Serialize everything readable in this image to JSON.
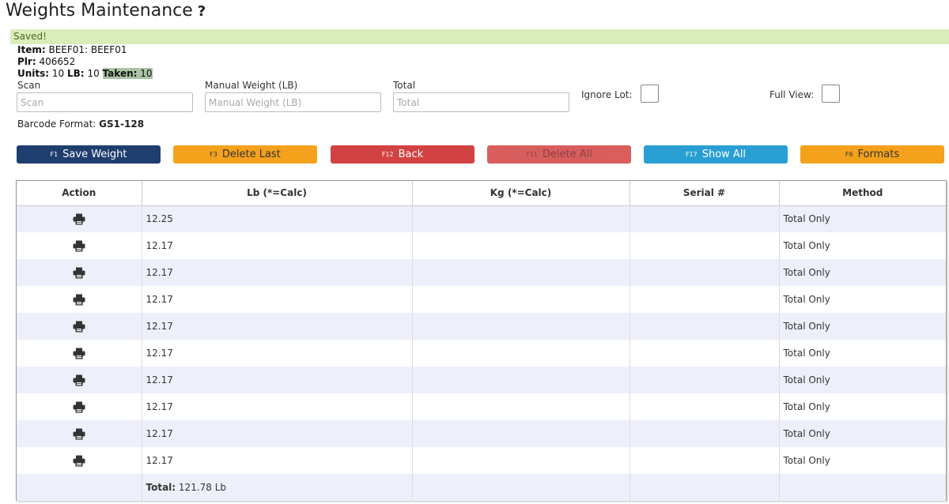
{
  "header": {
    "title": "Weights Maintenance",
    "help": "?"
  },
  "alert": {
    "text": "Saved!"
  },
  "info": {
    "item_label": "Item:",
    "item_value": "BEEF01: BEEF01",
    "plr_label": "Plr:",
    "plr_value": "406652",
    "units_label": "Units:",
    "units_value": "10",
    "lb_label": "LB:",
    "lb_value": "10",
    "taken_label": "Taken:",
    "taken_value": "10"
  },
  "form": {
    "scan": {
      "label": "Scan",
      "placeholder": "Scan"
    },
    "manual": {
      "label": "Manual Weight (LB)",
      "placeholder": "Manual Weight (LB)"
    },
    "total": {
      "label": "Total",
      "placeholder": "Total"
    },
    "ignore_lot": {
      "label": "Ignore Lot:"
    },
    "full_view": {
      "label": "Full View:"
    }
  },
  "barcode": {
    "label": "Barcode Format:",
    "value": "GS1-128"
  },
  "buttons": {
    "save": {
      "key": "F1",
      "label": "Save Weight"
    },
    "delete_last": {
      "key": "F3",
      "label": "Delete Last"
    },
    "back": {
      "key": "F12",
      "label": "Back"
    },
    "delete_all": {
      "key": "F11",
      "label": "Delete All"
    },
    "show_all": {
      "key": "F17",
      "label": "Show All"
    },
    "formats": {
      "key": "F6",
      "label": "Formats"
    }
  },
  "table": {
    "headers": [
      "Action",
      "Lb (*=Calc)",
      "Kg (*=Calc)",
      "Serial #",
      "Method"
    ],
    "rows": [
      {
        "lb": "12.25",
        "kg": "",
        "serial": "",
        "method": "Total Only"
      },
      {
        "lb": "12.17",
        "kg": "",
        "serial": "",
        "method": "Total Only"
      },
      {
        "lb": "12.17",
        "kg": "",
        "serial": "",
        "method": "Total Only"
      },
      {
        "lb": "12.17",
        "kg": "",
        "serial": "",
        "method": "Total Only"
      },
      {
        "lb": "12.17",
        "kg": "",
        "serial": "",
        "method": "Total Only"
      },
      {
        "lb": "12.17",
        "kg": "",
        "serial": "",
        "method": "Total Only"
      },
      {
        "lb": "12.17",
        "kg": "",
        "serial": "",
        "method": "Total Only"
      },
      {
        "lb": "12.17",
        "kg": "",
        "serial": "",
        "method": "Total Only"
      },
      {
        "lb": "12.17",
        "kg": "",
        "serial": "",
        "method": "Total Only"
      },
      {
        "lb": "12.17",
        "kg": "",
        "serial": "",
        "method": "Total Only"
      }
    ],
    "total_label": "Total:",
    "total_value": "121.78 Lb"
  },
  "icons": {
    "row_action": "printer-icon"
  }
}
